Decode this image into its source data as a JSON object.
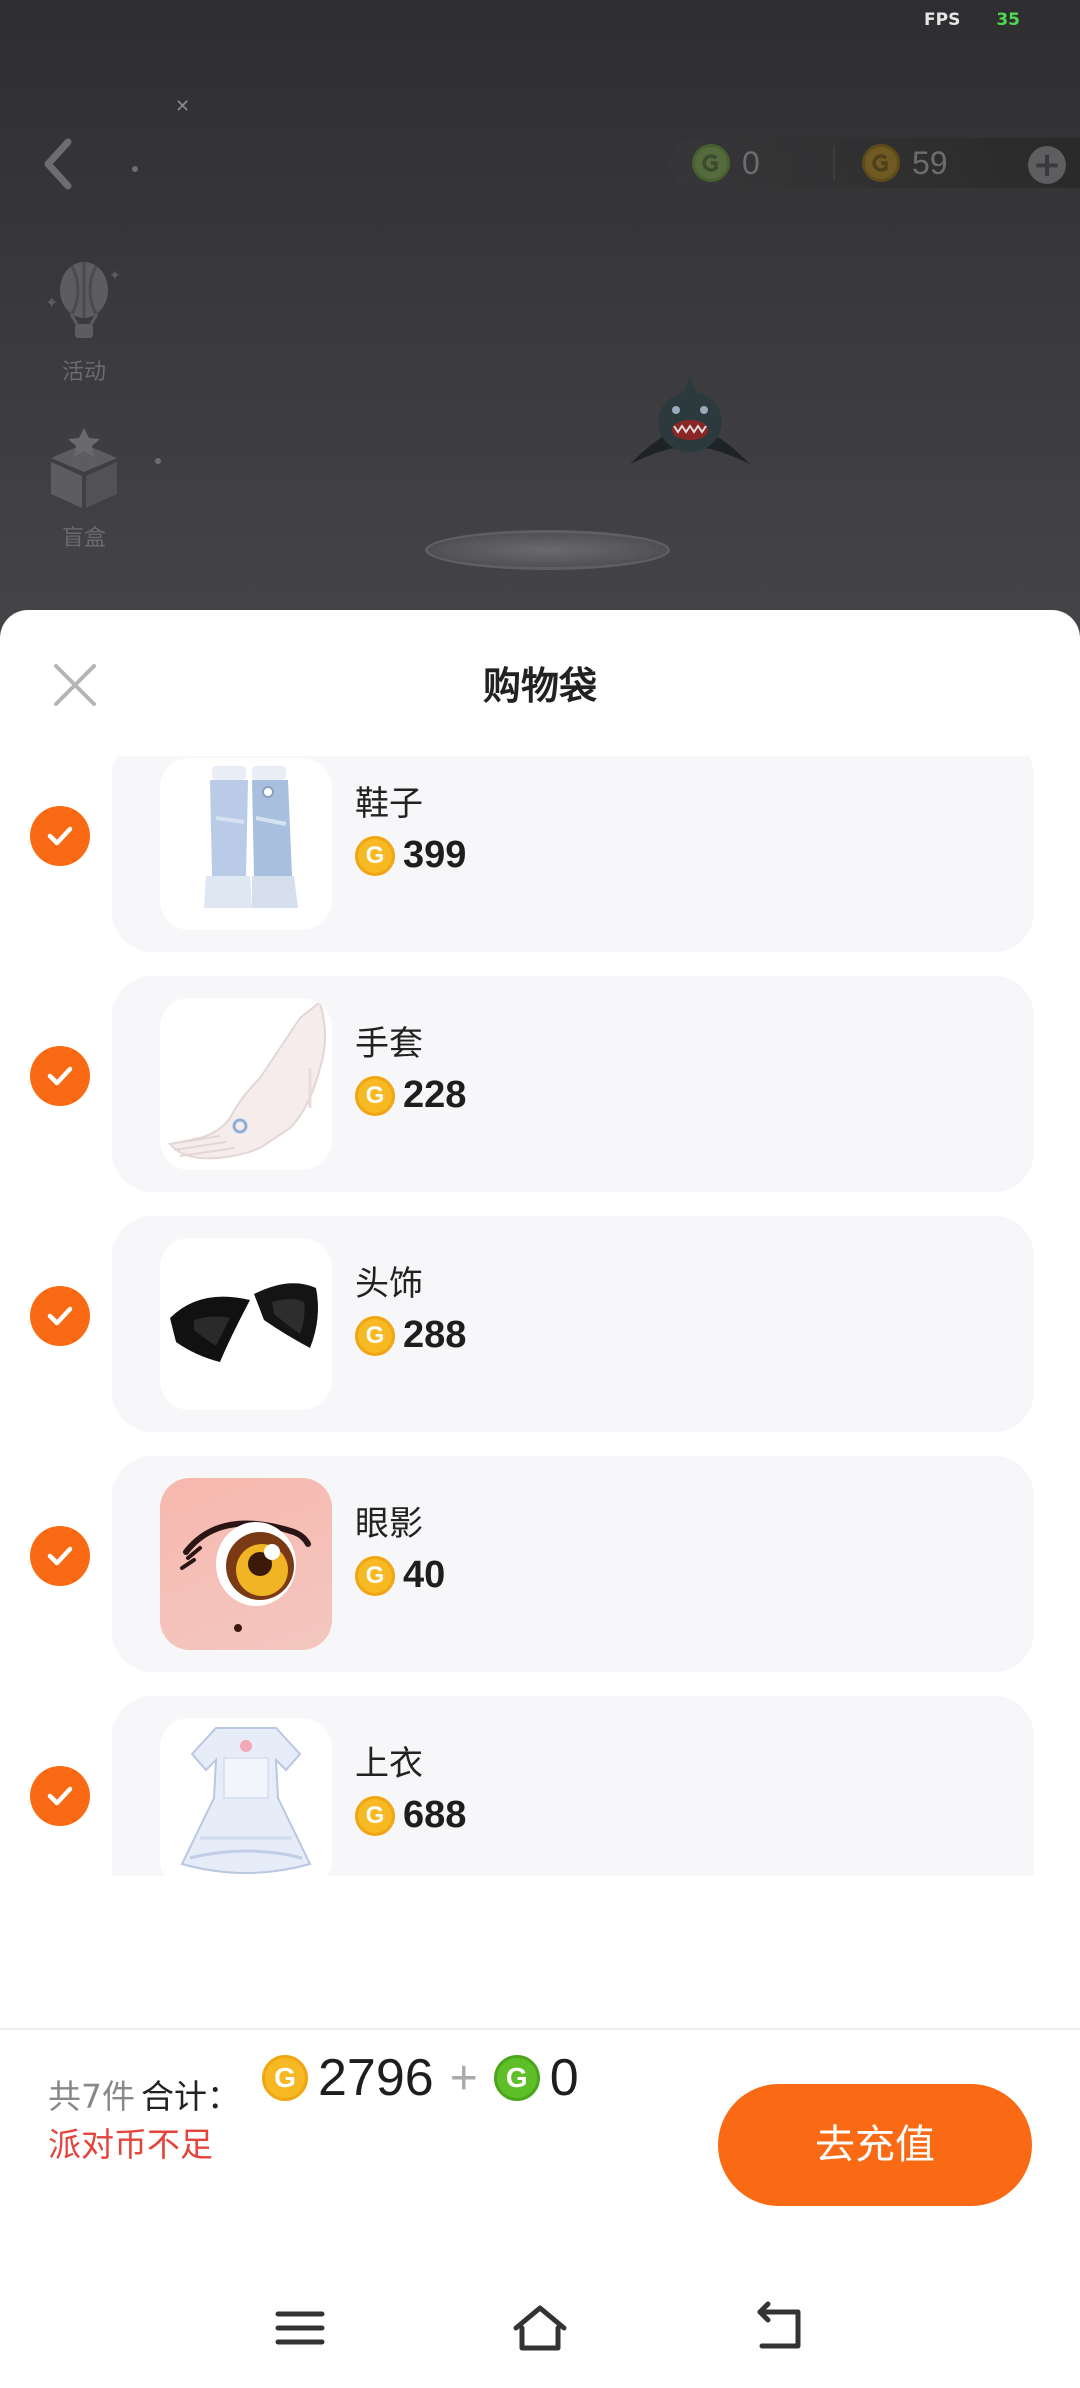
{
  "status": {
    "fps_label": "FPS",
    "fps_value": "35"
  },
  "currency": {
    "party_coin": "0",
    "gold_coin": "59"
  },
  "sidebar": {
    "activity_label": "活动",
    "blindbox_label": "盲盒"
  },
  "sheet": {
    "title": "购物袋",
    "items": [
      {
        "name": "鞋子",
        "price": "399",
        "checked": true
      },
      {
        "name": "手套",
        "price": "228",
        "checked": true
      },
      {
        "name": "头饰",
        "price": "288",
        "checked": true
      },
      {
        "name": "眼影",
        "price": "40",
        "checked": true
      },
      {
        "name": "上衣",
        "price": "688",
        "checked": true
      }
    ]
  },
  "footer": {
    "count_text": "共7件",
    "total_label": "合计：",
    "gold_total": "2796",
    "plus_sign": "+",
    "party_total": "0",
    "warning": "派对币不足",
    "recharge_label": "去充值"
  },
  "colors": {
    "accent": "#fa6a14",
    "warning": "#e5443c",
    "gold": "#f6b923",
    "green": "#5fbf29"
  }
}
